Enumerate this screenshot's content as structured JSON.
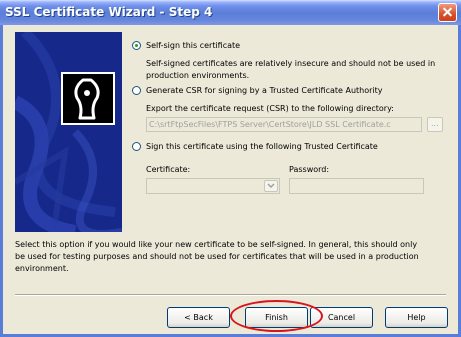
{
  "window": {
    "title": "SSL Certificate Wizard - Step 4"
  },
  "options": {
    "self_sign": {
      "label": "Self-sign this certificate",
      "desc_line1": "Self-signed certificates are relatively insecure and should not be used in",
      "desc_line2": "production environments.",
      "selected": true
    },
    "csr": {
      "label": "Generate CSR for signing by a Trusted Certificate Authority",
      "export_label": "Export the certificate request (CSR) to the following directory:",
      "path_value": "C:\\srtFtpSecFiles\\FTPS Server\\CertStore\\JLD SSL Certificate.c",
      "browse_label": "...",
      "selected": false
    },
    "trusted": {
      "label": "Sign this certificate using  the following Trusted Certificate",
      "certificate_label": "Certificate:",
      "certificate_value": "",
      "password_label": "Password:",
      "password_value": "",
      "selected": false
    }
  },
  "help_text": {
    "line1": "Select this option if you would like your new certificate to be self-signed. In general, this should only",
    "line2": "be used for testing purposes and should not be used for certificates that will be used in a production",
    "line3": "environment."
  },
  "buttons": {
    "back": "< Back",
    "finish": "Finish",
    "cancel": "Cancel",
    "help": "Help"
  },
  "colors": {
    "title_bar": "#5a7ed8",
    "side_panel": "#16298b",
    "highlight_ellipse": "#d8141d",
    "dialog_bg": "#ece9d8"
  },
  "icons": {
    "side_panel": "certificate-wizard-icon",
    "close": "close-icon",
    "dropdown": "chevron-down-icon"
  }
}
